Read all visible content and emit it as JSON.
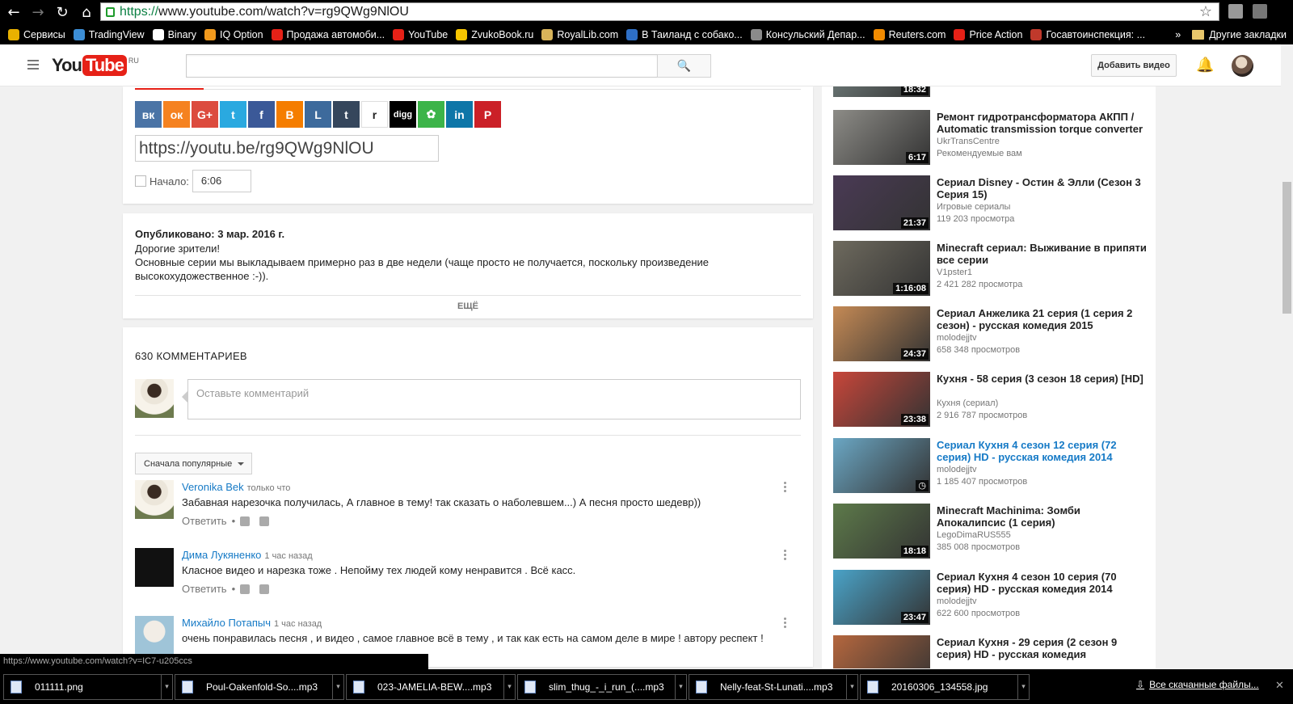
{
  "browser": {
    "url_scheme": "https://",
    "url_rest": "www.youtube.com/watch?v=rg9QWg9NlOU",
    "bookmarks": [
      {
        "label": "Сервисы",
        "color": "#e8b100"
      },
      {
        "label": "TradingView",
        "color": "#3c8ed6"
      },
      {
        "label": "Binary",
        "color": "#ffffff"
      },
      {
        "label": "IQ Option",
        "color": "#f29a1d"
      },
      {
        "label": "Продажа автомоби...",
        "color": "#e62117"
      },
      {
        "label": "YouTube",
        "color": "#e62117"
      },
      {
        "label": "ZvukoBook.ru",
        "color": "#f7c600"
      },
      {
        "label": "RoyalLib.com",
        "color": "#d8b45a"
      },
      {
        "label": "В Таиланд с собако...",
        "color": "#2e6fc6"
      },
      {
        "label": "Консульский Депар...",
        "color": "#8a8a8a"
      },
      {
        "label": "Reuters.com",
        "color": "#f28b00"
      },
      {
        "label": "Price Action",
        "color": "#e62117"
      },
      {
        "label": "Госавтоинспекция: ...",
        "color": "#c0392b"
      }
    ],
    "more": "»",
    "other_bookmarks": "Другие закладки",
    "status_url": "https://www.youtube.com/watch?v=IC7-u205ccs"
  },
  "header": {
    "logo_you": "You",
    "logo_tube": "Tube",
    "logo_region": "RU",
    "upload_label": "Добавить видео"
  },
  "share": {
    "social": [
      {
        "label": "вк",
        "color": "#4b74a6"
      },
      {
        "label": "ок",
        "color": "#f58220"
      },
      {
        "label": "G+",
        "color": "#dc4b3e"
      },
      {
        "label": "t",
        "color": "#2aa9e0"
      },
      {
        "label": "f",
        "color": "#3b5998"
      },
      {
        "label": "B",
        "color": "#f57d00"
      },
      {
        "label": "L",
        "color": "#3d6a9c"
      },
      {
        "label": "t",
        "color": "#35465c"
      },
      {
        "label": "r",
        "color": "#cee3f8"
      },
      {
        "label": "digg",
        "color": "#000000"
      },
      {
        "label": "✿",
        "color": "#3cb449"
      },
      {
        "label": "in",
        "color": "#0e76a8"
      },
      {
        "label": "P",
        "color": "#cb2027"
      }
    ],
    "url": "https://youtu.be/rg9QWg9NlOU",
    "start_label": "Начало:",
    "start_value": "6:06"
  },
  "description": {
    "published": "Опубликовано: 3 мар. 2016 г.",
    "line1": "Дорогие зрители!",
    "line2": "Основные серии мы выкладываем примерно раз в две недели (чаще просто не получается, поскольку произведение высокохудожественное :-)).",
    "more": "ЕЩЁ"
  },
  "comments": {
    "count": "630 КОММЕНТАРИЕВ",
    "placeholder": "Оставьте комментарий",
    "sort": "Сначала популярные",
    "reply": "Ответить",
    "items": [
      {
        "author": "Veronika Bek",
        "time": "только что",
        "text": "Забавная нарезочка получилась, А главное в тему! так сказать о наболевшем...) А песня просто шедевр))"
      },
      {
        "author": "Дима Лукяненко",
        "time": "1 час назад",
        "text": "Класное видео и нарезка тоже . Непойму тех людей кому ненравится . Всё касс."
      },
      {
        "author": "Михайло Потапыч",
        "time": "1 час назад",
        "text": "очень понравилась песня , и видео , самое главное всё в тему , и так как есть на самом деле в мире ! автору респект !"
      }
    ]
  },
  "related": [
    {
      "title": "",
      "channel": "",
      "views": "",
      "duration": "18:32",
      "color": "#7b8a88"
    },
    {
      "title": "Ремонт гидротрансформатора АКПП / Automatic transmission torque converter",
      "channel": "UkrTransCentre",
      "views": "Рекомендуемые вам",
      "duration": "6:17",
      "color": "#8d8c87"
    },
    {
      "title": "Сериал Disney - Остин & Элли (Сезон 3 Серия 15)",
      "channel": "Игровые сериалы",
      "views": "119 203 просмотра",
      "duration": "21:37",
      "color": "#4a3a55"
    },
    {
      "title": "Minecraft сериал: Выживание в припяти все серии",
      "channel": "V1pster1",
      "views": "2 421 282 просмотра",
      "duration": "1:16:08",
      "color": "#6e6a5e"
    },
    {
      "title": "Сериал Анжелика 21 серия (1 серия 2 сезон) - русская комедия 2015",
      "channel": "molodejjtv",
      "views": "658 348 просмотров",
      "duration": "24:37",
      "color": "#c58a55"
    },
    {
      "title": "Кухня - 58 серия (3 сезон 18 серия) [HD]",
      "channel": "Кухня (сериал)",
      "views": "2 916 787 просмотров",
      "duration": "23:38",
      "color": "#c8463a"
    },
    {
      "title": "Сериал Кухня 4 сезон 12 серия (72 серия) HD - русская комедия 2014",
      "channel": "molodejjtv",
      "views": "1 185 407 просмотров",
      "duration": "",
      "color": "#6ba7c4"
    },
    {
      "title": "Minecraft Machinima: Зомби Апокалипсис (1 серия)",
      "channel": "LegoDimaRUS555",
      "views": "385 008 просмотров",
      "duration": "18:18",
      "color": "#5d7a4a"
    },
    {
      "title": "Сериал Кухня 4 сезон 10 серия (70 серия) HD - русская комедия 2014",
      "channel": "molodejjtv",
      "views": "622 600 просмотров",
      "duration": "23:47",
      "color": "#4aa3c8"
    },
    {
      "title": "Сериал Кухня - 29 серия (2 сезон 9 серия) HD - русская комедия",
      "channel": "",
      "views": "",
      "duration": "",
      "color": "#b5673e"
    }
  ],
  "downloads": {
    "items": [
      "011111.png",
      "Poul-Oakenfold-So....mp3",
      "023-JAMELIA-BEW....mp3",
      "slim_thug_-_i_run_(....mp3",
      "Nelly-feat-St-Lunati....mp3",
      "20160306_134558.jpg"
    ],
    "all": "Все скачанные файлы..."
  }
}
